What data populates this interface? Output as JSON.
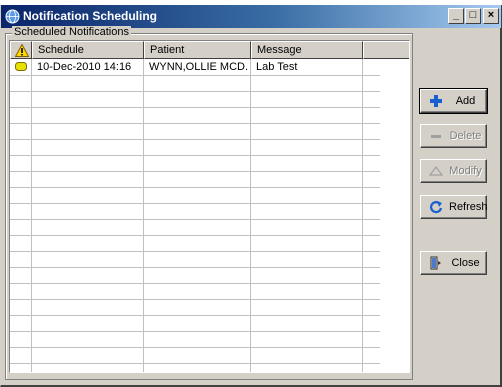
{
  "window": {
    "title": "Notification Scheduling",
    "controls": {
      "minimize": "_",
      "maximize": "□",
      "close": "×"
    }
  },
  "group": {
    "label": "Scheduled Notifications"
  },
  "table": {
    "columns": [
      {
        "label": "",
        "icon": "warning-icon"
      },
      {
        "label": "Schedule"
      },
      {
        "label": "Patient"
      },
      {
        "label": "Message"
      }
    ],
    "rows": [
      {
        "status_icon": "pending-indicator-icon",
        "schedule": "10-Dec-2010 14:16",
        "patient": "WYNN,OLLIE MCD...",
        "message": "Lab Test"
      }
    ]
  },
  "buttons": {
    "add": {
      "label": "Add",
      "icon": "plus-icon",
      "enabled": true
    },
    "delete": {
      "label": "Delete",
      "icon": "minus-icon",
      "enabled": false
    },
    "modify": {
      "label": "Modify",
      "icon": "triangle-icon",
      "enabled": false
    },
    "refresh": {
      "label": "Refresh",
      "icon": "refresh-icon",
      "enabled": true
    },
    "close": {
      "label": "Close",
      "icon": "exit-door-icon",
      "enabled": true
    }
  },
  "colors": {
    "title_start": "#0a246a",
    "title_end": "#a6caf0",
    "face": "#d4d0c8",
    "warning": "#ffd800",
    "indicator": "#e8e000",
    "add_icon": "#1a5fd0"
  }
}
